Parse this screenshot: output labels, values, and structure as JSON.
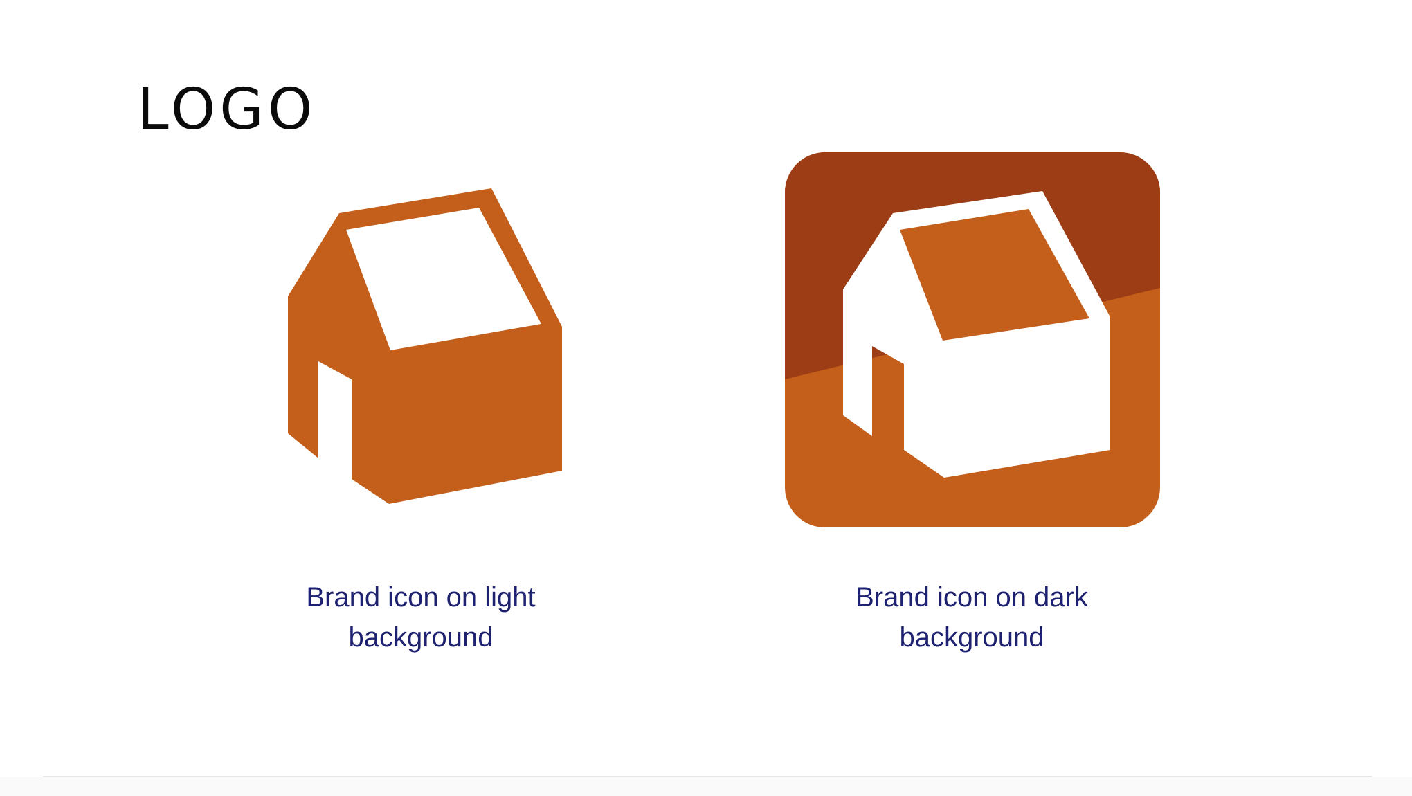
{
  "page": {
    "heading": "LOGO"
  },
  "logos": {
    "light": {
      "caption": "Brand icon on light background",
      "icon": "house-icon"
    },
    "dark": {
      "caption": "Brand icon on dark background",
      "icon": "house-icon"
    }
  },
  "colors": {
    "brand_orange": "#C45E1B",
    "dark_orange": "#9C3D15",
    "caption_text": "#1E2170",
    "heading_text": "#0B0B0B"
  }
}
